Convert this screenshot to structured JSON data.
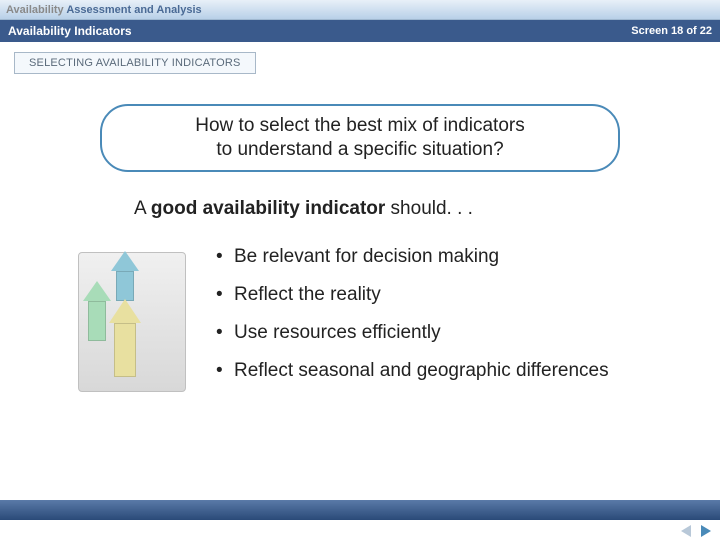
{
  "header": {
    "title_grey": "Availability ",
    "title_blue": "Assessment and Analysis"
  },
  "subheader": {
    "title": "Availability Indicators",
    "screen_label": "Screen 18 of 22"
  },
  "section_label": "SELECTING AVAILABILITY INDICATORS",
  "question": {
    "line1": "How to select the best mix of indicators",
    "line2": "to understand a specific situation?"
  },
  "lead": {
    "prefix": "A ",
    "bold": "good availability indicator",
    "suffix": " should. . ."
  },
  "bullets": [
    "Be relevant for decision making",
    "Reflect the reality",
    "Use resources efficiently",
    "Reflect seasonal and geographic differences"
  ]
}
